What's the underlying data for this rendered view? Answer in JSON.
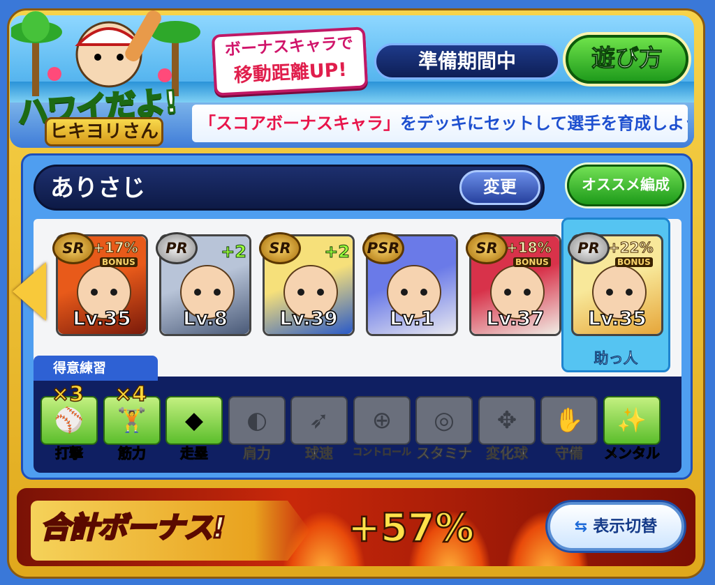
{
  "event": {
    "logo_title": "ハワイだよ!",
    "logo_subtitle": "ヒキヨリさん",
    "promo_line1": "ボーナスキャラで",
    "promo_line2": "移動距離UP!",
    "phase": "準備期間中",
    "howto_label": "遊び方",
    "instruction_highlight": "「スコアボーナスキャラ」",
    "instruction_rest": "をデッキにセットして選手を育成しよう!"
  },
  "deck": {
    "name": "ありさじ",
    "change_label": "変更",
    "recommend_label": "オススメ編成"
  },
  "cards": [
    {
      "rarity": "SR",
      "bonus_pct": "+17%",
      "bonus_label": "BONUS",
      "plus": "",
      "level": "Lv.35",
      "colors": [
        "#e85a1a",
        "#7a1a0a"
      ]
    },
    {
      "rarity": "PR",
      "bonus_pct": "",
      "bonus_label": "",
      "plus": "+2",
      "level": "Lv.8",
      "colors": [
        "#b8c4d8",
        "#4a5a78"
      ]
    },
    {
      "rarity": "SR",
      "bonus_pct": "",
      "bonus_label": "",
      "plus": "+2",
      "level": "Lv.39",
      "colors": [
        "#f6e07a",
        "#2a5ac8"
      ]
    },
    {
      "rarity": "PSR",
      "bonus_pct": "",
      "bonus_label": "",
      "plus": "",
      "level": "Lv.1",
      "colors": [
        "#6a7ae8",
        "#e8e8f0"
      ]
    },
    {
      "rarity": "SR",
      "bonus_pct": "+18%",
      "bonus_label": "BONUS",
      "plus": "",
      "level": "Lv.37",
      "colors": [
        "#d8324a",
        "#f0ece4"
      ]
    },
    {
      "rarity": "PR",
      "bonus_pct": "+22%",
      "bonus_label": "BONUS",
      "plus": "",
      "level": "Lv.35",
      "colors": [
        "#f8e89a",
        "#e6a63a"
      ]
    }
  ],
  "helper_label": "助っ人",
  "practice": {
    "tab_label": "得意練習",
    "items": [
      {
        "label": "打撃",
        "active": true,
        "multiplier": "×3",
        "icon": "bat-icon",
        "glyph": "⚾"
      },
      {
        "label": "筋力",
        "active": true,
        "multiplier": "×4",
        "icon": "dumbbell-icon",
        "glyph": "🏋"
      },
      {
        "label": "走塁",
        "active": true,
        "multiplier": "",
        "icon": "base-icon",
        "glyph": "◆"
      },
      {
        "label": "肩力",
        "active": false,
        "multiplier": "",
        "icon": "throw-icon",
        "glyph": "◐"
      },
      {
        "label": "球速",
        "active": false,
        "multiplier": "",
        "icon": "fastball-icon",
        "glyph": "➶"
      },
      {
        "label": "コントロール",
        "active": false,
        "multiplier": "",
        "icon": "target-icon",
        "glyph": "⊕"
      },
      {
        "label": "スタミナ",
        "active": false,
        "multiplier": "",
        "icon": "tire-icon",
        "glyph": "◎"
      },
      {
        "label": "変化球",
        "active": false,
        "multiplier": "",
        "icon": "breaking-ball-icon",
        "glyph": "✥"
      },
      {
        "label": "守備",
        "active": false,
        "multiplier": "",
        "icon": "glove-icon",
        "glyph": "✋"
      },
      {
        "label": "メンタル",
        "active": true,
        "multiplier": "",
        "icon": "sparkle-cloud-icon",
        "glyph": "✨"
      }
    ]
  },
  "total": {
    "label": "合計ボーナス!",
    "value": "+57%",
    "toggle_label": "表示切替"
  }
}
